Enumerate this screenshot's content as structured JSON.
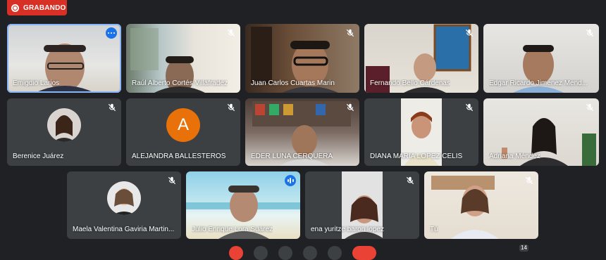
{
  "recording": {
    "label": "GRABANDO",
    "color": "#d93025"
  },
  "participants": [
    {
      "name": "Emigdio Larios",
      "state": "more-options"
    },
    {
      "name": "Raúl Alberto Cortés Villafradez",
      "state": "muted"
    },
    {
      "name": "Juan Carlos Cuartas Marin",
      "state": "muted"
    },
    {
      "name": "Fernando Bello Cárdenas",
      "state": "muted"
    },
    {
      "name": "Edgar Ricardo Jimenez Mend...",
      "state": "muted"
    },
    {
      "name": "Berenice Juárez",
      "state": "muted"
    },
    {
      "name": "ALEJANDRA BALLESTEROS",
      "state": "muted",
      "avatar_letter": "A"
    },
    {
      "name": "EDER LUNA CERQUERA",
      "state": "muted"
    },
    {
      "name": "DIANA MARIA LOPEZ CELIS",
      "state": "muted"
    },
    {
      "name": "Adriana Méndez",
      "state": "muted"
    },
    {
      "name": "Maela Valentina Gaviria Martin...",
      "state": "muted"
    },
    {
      "name": "Julio Enrique Lora Suárez",
      "state": "speaking"
    },
    {
      "name": "ena yuritze baron lopez",
      "state": "muted"
    },
    {
      "name": "Tú",
      "state": "muted"
    }
  ],
  "participant_count": "14",
  "colors": {
    "background": "#202124",
    "tile": "#3c4043",
    "active_outline": "#8ab4f8",
    "accent": "#1a73e8",
    "avatar": "#e8710a"
  }
}
